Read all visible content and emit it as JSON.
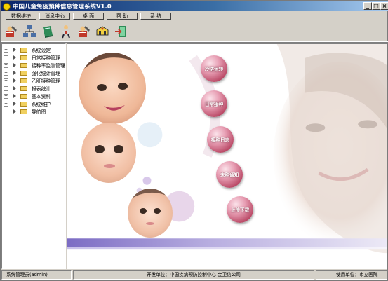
{
  "window": {
    "title": "中国儿童免疫预种信息管理系统V1.0",
    "controls": [
      "_",
      "□",
      "×"
    ]
  },
  "menu": {
    "items": [
      {
        "label": "数据维护"
      },
      {
        "label": "消息中心"
      },
      {
        "label": "桌 面"
      },
      {
        "label": "帮 助"
      },
      {
        "label": "系 统"
      }
    ]
  },
  "toolbar": {
    "icons": [
      "user-edit-icon",
      "network-icon",
      "book-icon",
      "person-icon",
      "user-edit-icon-2",
      "vehicle-icon",
      "exit-icon"
    ]
  },
  "tree": {
    "items": [
      {
        "label": "系统设定",
        "expander": "+"
      },
      {
        "label": "日常接种管理",
        "expander": "+"
      },
      {
        "label": "接种率监测管理",
        "expander": "+"
      },
      {
        "label": "强化统计管理",
        "expander": "+"
      },
      {
        "label": "乙肝接种管理",
        "expander": "+"
      },
      {
        "label": "报表统计",
        "expander": "+"
      },
      {
        "label": "基本资料",
        "expander": "+"
      },
      {
        "label": "系统维护",
        "expander": "+"
      },
      {
        "label": "导航图",
        "expander": ""
      }
    ]
  },
  "main": {
    "nav_buttons": [
      {
        "label": "冷链运转"
      },
      {
        "label": "日常接种"
      },
      {
        "label": "接种日志"
      },
      {
        "label": "未种通知"
      },
      {
        "label": "上传下载"
      }
    ]
  },
  "status": {
    "user": "系统管理员(admin)",
    "developer": "开发单位：中国疾病预防控制中心  金卫信公司",
    "user_unit": "使用单位：市立医院"
  },
  "colors": {
    "title_start": "#0a246a",
    "title_end": "#a6caf0",
    "nav_ball": "#b5405e",
    "band": "#8878c8"
  }
}
